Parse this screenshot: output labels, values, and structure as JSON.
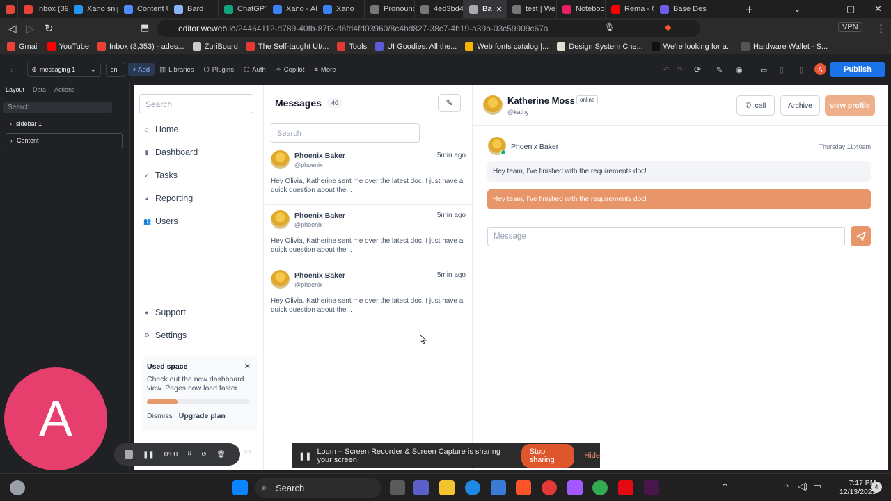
{
  "browser": {
    "tabs": [
      {
        "label": "",
        "color": "#e5453a"
      },
      {
        "label": "Inbox (39",
        "color": "#ea4335"
      },
      {
        "label": "Xano snip",
        "color": "#2196f3"
      },
      {
        "label": "Content U",
        "color": "#4f8cff"
      },
      {
        "label": "Bard",
        "color": "#8ab4f8"
      },
      {
        "label": "ChatGPT",
        "color": "#10a37f"
      },
      {
        "label": "Xano - AP",
        "color": "#3b82f6"
      },
      {
        "label": "Xano",
        "color": "#3b82f6"
      },
      {
        "label": "Pronounc",
        "color": "#777777"
      },
      {
        "label": "4ed3bd4",
        "color": "#777777"
      },
      {
        "label": "Ba",
        "color": "#aaaaaa",
        "active": true
      },
      {
        "label": "test | We",
        "color": "#777777"
      },
      {
        "label": "Noteboo",
        "color": "#e91e63"
      },
      {
        "label": "Rema - C",
        "color": "#ff0000"
      },
      {
        "label": "Base Desi",
        "color": "#6c5ce7"
      }
    ],
    "url_host": "editor.weweb.io",
    "url_path": "/24464112-d789-40fb-87f3-d6fd4fd03960/8c4bd827-38c7-4b19-a39b-03c59909c67a",
    "vpn_label": "VPN",
    "bookmarks": [
      {
        "label": "Gmail",
        "color": "#ea4335"
      },
      {
        "label": "YouTube",
        "color": "#ff0000"
      },
      {
        "label": "Inbox (3,353) - ades...",
        "color": "#ea4335"
      },
      {
        "label": "ZuriBoard",
        "color": "#cccccc"
      },
      {
        "label": "The Self-taught UI/...",
        "color": "#e53935"
      },
      {
        "label": "Tools",
        "color": "#e53935"
      },
      {
        "label": "UI Goodies: All the...",
        "color": "#5b5bd6"
      },
      {
        "label": "Web fonts catalog |...",
        "color": "#f4b400"
      },
      {
        "label": "Design System Che...",
        "color": "#e0e0d0"
      },
      {
        "label": "We're looking for a...",
        "color": "#111111"
      },
      {
        "label": "Hardware Wallet - S...",
        "color": "#555555"
      }
    ]
  },
  "editor": {
    "project": "messaging 1",
    "lang": "en",
    "toolbar": [
      "+ Add",
      "Libraries",
      "Plugins",
      "Auth",
      "Copilot",
      "More"
    ],
    "publish": "Publish",
    "user_initial": "A",
    "panel_tabs": [
      "Layout",
      "Data",
      "Actions"
    ],
    "panel_search": "Search",
    "tree": [
      "sidebar 1",
      "Content"
    ]
  },
  "app": {
    "nav_search": "Search",
    "nav_items": [
      "Home",
      "Dashboard",
      "Tasks",
      "Reporting",
      "Users"
    ],
    "nav_bottom": [
      "Support",
      "Settings"
    ],
    "used_space": {
      "title": "Used space",
      "desc": "Check out the new dashboard view. Pages now load faster.",
      "progress": 0.3,
      "dismiss": "Dismiss",
      "upgrade": "Upgrade plan"
    },
    "messages": {
      "title": "Messages",
      "count": "40",
      "search": "Search",
      "items": [
        {
          "name": "Phoenix Baker",
          "handle": "@phoenix",
          "time": "5min ago",
          "preview": "Hey Olivia, Katherine sent me over the latest doc. I just have a quick question about the..."
        },
        {
          "name": "Phoenix Baker",
          "handle": "@phoenix",
          "time": "5min ago",
          "preview": "Hey Olivia, Katherine sent me over the latest doc. I just have a quick question about the..."
        },
        {
          "name": "Phoenix Baker",
          "handle": "@phoenix",
          "time": "5min ago",
          "preview": "Hey Olivia, Katherine sent me over the latest doc. I just have a quick question about the..."
        }
      ]
    },
    "chat": {
      "name": "Katherine Moss",
      "status": "online",
      "handle": "@kathy",
      "call": "call",
      "archive": "Archive",
      "view_profile": "view profile",
      "sender": "Phoenix Baker",
      "time": "Thursday 11:40am",
      "bubble1": "Hey team, I've finished with the requirements doc!",
      "bubble2": "Hey team, I've finished with the requirements doc!",
      "input_placeholder": "Message"
    }
  },
  "overlay": {
    "avatar_letter": "A",
    "timer": "0:00",
    "loom_text": "Loom – Screen Recorder & Screen Capture is sharing your screen.",
    "stop_sharing": "Stop sharing",
    "hide": "Hide"
  },
  "taskbar": {
    "search": "Search",
    "time": "7:17 PM",
    "date": "12/13/2023"
  }
}
